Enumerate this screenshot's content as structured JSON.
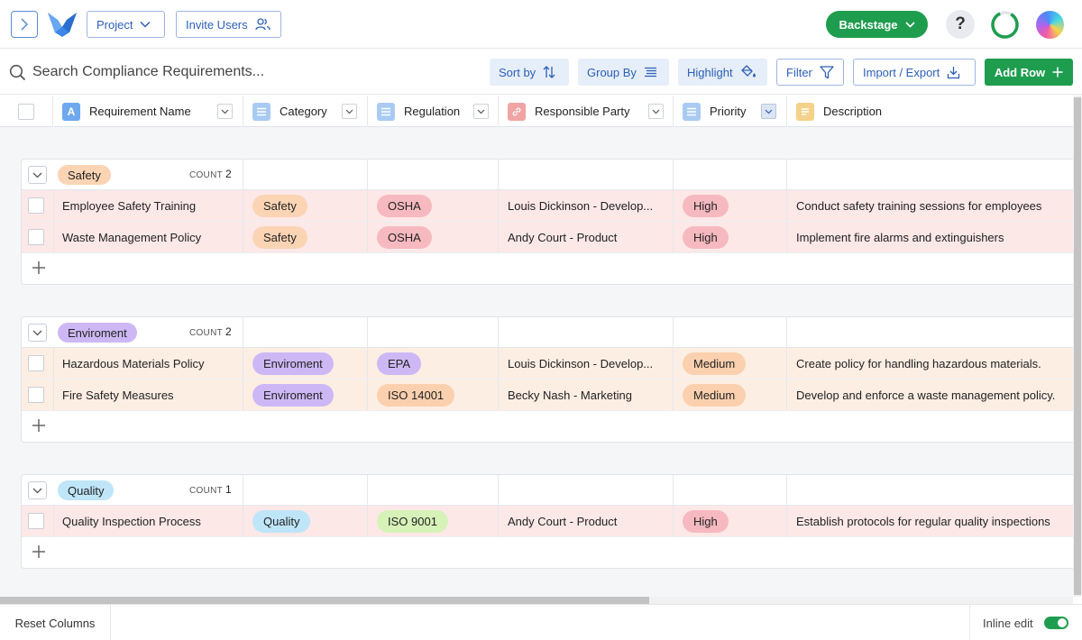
{
  "topbar": {
    "project_label": "Project",
    "invite_label": "Invite Users",
    "backstage_label": "Backstage",
    "help_label": "?"
  },
  "toolbar": {
    "search_placeholder": "Search Compliance Requirements...",
    "sort_label": "Sort by",
    "group_label": "Group By",
    "highlight_label": "Highlight",
    "filter_label": "Filter",
    "import_label": "Import / Export",
    "add_row_label": "Add Row"
  },
  "columns": [
    {
      "label": "Requirement Name",
      "icon": "text-type-icon",
      "icon_glyph": "A",
      "color": "#6ea8ee"
    },
    {
      "label": "Category",
      "icon": "list-type-icon",
      "color": "#a9cbf3"
    },
    {
      "label": "Regulation",
      "icon": "list-type-icon",
      "color": "#a9cbf3"
    },
    {
      "label": "Responsible Party",
      "icon": "link-type-icon",
      "color": "#f2a4a4"
    },
    {
      "label": "Priority",
      "icon": "list-type-icon",
      "color": "#a9cbf3"
    },
    {
      "label": "Description",
      "icon": "notes-type-icon",
      "color": "#f5d28a"
    }
  ],
  "groups": [
    {
      "name": "Safety",
      "badge_color": "#fbd4b4",
      "count_label": "COUNT",
      "count": "2",
      "rows": [
        {
          "name": "Employee Safety Training",
          "category": "Safety",
          "category_color": "#fbd4b4",
          "regulation": "OSHA",
          "regulation_color": "#f7b9c0",
          "party": "Louis Dickinson - Develop...",
          "priority": "High",
          "priority_color": "#f7b9c0",
          "description": "Conduct safety training sessions for employees",
          "row_color": "#fde8e8"
        },
        {
          "name": "Waste Management Policy",
          "category": "Safety",
          "category_color": "#fbd4b4",
          "regulation": "OSHA",
          "regulation_color": "#f7b9c0",
          "party": "Andy Court - Product",
          "priority": "High",
          "priority_color": "#f7b9c0",
          "description": "Implement fire alarms and extinguishers",
          "row_color": "#fde8e8"
        }
      ]
    },
    {
      "name": "Enviroment",
      "badge_color": "#cdb8f5",
      "count_label": "COUNT",
      "count": "2",
      "rows": [
        {
          "name": "Hazardous Materials Policy",
          "category": "Enviroment",
          "category_color": "#cdb8f5",
          "regulation": "EPA",
          "regulation_color": "#cdb8f5",
          "party": "Louis Dickinson - Develop...",
          "priority": "Medium",
          "priority_color": "#fbd0ae",
          "description": "Create policy for handling hazardous materials.",
          "row_color": "#fdeee4"
        },
        {
          "name": "Fire Safety Measures",
          "category": "Enviroment",
          "category_color": "#cdb8f5",
          "regulation": "ISO 14001",
          "regulation_color": "#fbd0ae",
          "party": "Becky Nash - Marketing",
          "priority": "Medium",
          "priority_color": "#fbd0ae",
          "description": "Develop and enforce a waste management policy.",
          "row_color": "#fdeee4"
        }
      ]
    },
    {
      "name": "Quality",
      "badge_color": "#bfe5f8",
      "count_label": "COUNT",
      "count": "1",
      "rows": [
        {
          "name": "Quality Inspection Process",
          "category": "Quality",
          "category_color": "#bfe5f8",
          "regulation": "ISO 9001",
          "regulation_color": "#d6f2b8",
          "party": "Andy Court - Product",
          "priority": "High",
          "priority_color": "#f7b9c0",
          "description": "Establish protocols for regular quality inspections",
          "row_color": "#fde8e8"
        }
      ]
    }
  ],
  "footer": {
    "reset_label": "Reset Columns",
    "inline_edit_label": "Inline edit",
    "inline_edit_on": true
  },
  "colors": {
    "accent_green": "#1f9d4f",
    "accent_blue": "#2d5fb8"
  }
}
